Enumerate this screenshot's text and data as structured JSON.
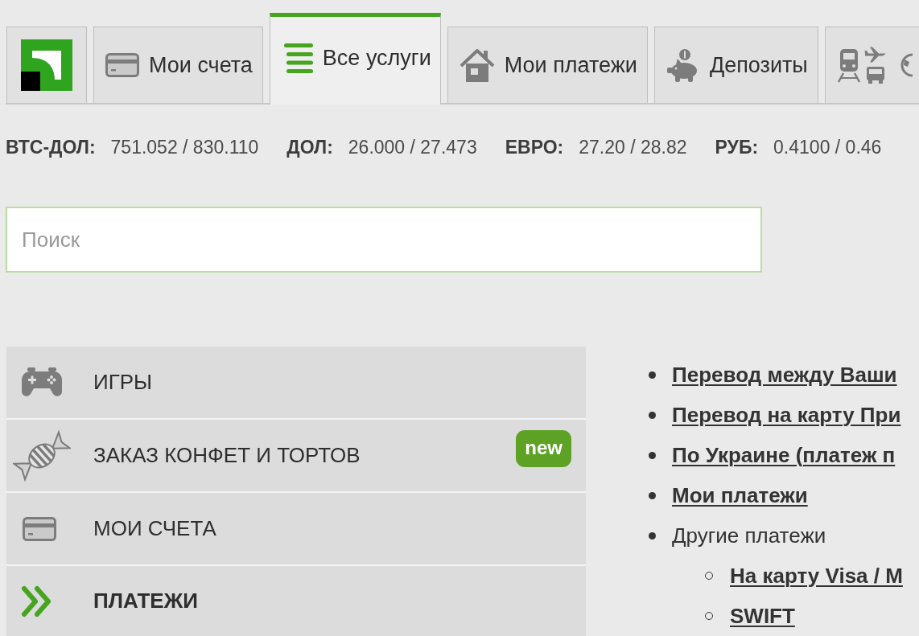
{
  "tabs": [
    {
      "kind": "label",
      "label": "Мои счета",
      "selected": false
    },
    {
      "kind": "label",
      "label": "Все услуги",
      "selected": true
    },
    {
      "kind": "label",
      "label": "Мои платежи",
      "selected": false
    },
    {
      "kind": "label",
      "label": "Депозиты",
      "selected": false
    },
    {
      "kind": "icons",
      "selected": false
    }
  ],
  "rates": [
    {
      "name": "ВТС-ДОЛ:",
      "value": "751.052 / 830.110"
    },
    {
      "name": "ДОЛ:",
      "value": "26.000 / 27.473"
    },
    {
      "name": "ЕВРО:",
      "value": "27.20 / 28.82"
    },
    {
      "name": "РУБ:",
      "value": "0.4100 / 0.46"
    }
  ],
  "search": {
    "placeholder": "Поиск"
  },
  "menu": [
    {
      "label": "ИГРЫ",
      "selected": false
    },
    {
      "label": "ЗАКАЗ КОНФЕТ И ТОРТОВ",
      "badge": "new",
      "selected": false
    },
    {
      "label": "МОИ СЧЕТА",
      "selected": false
    },
    {
      "label": "ПЛАТЕЖИ",
      "selected": true
    }
  ],
  "links": [
    {
      "kind": "link",
      "text": "Перевод между Ваши"
    },
    {
      "kind": "link",
      "text": "Перевод на карту При"
    },
    {
      "kind": "link",
      "text": "По Украине (платеж п"
    },
    {
      "kind": "link",
      "text": "Мои платежи"
    },
    {
      "kind": "text",
      "text": "Другие платежи",
      "children": [
        {
          "kind": "link",
          "text": "На карту Visa / M"
        },
        {
          "kind": "link",
          "text": "SWIFT"
        }
      ]
    }
  ]
}
